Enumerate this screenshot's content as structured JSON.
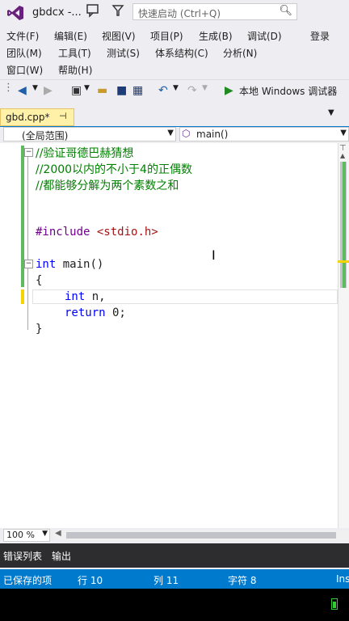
{
  "window": {
    "title": "gbdcx -..."
  },
  "quick_launch": {
    "placeholder": "快速启动 (Ctrl+Q)"
  },
  "menu": {
    "row1": [
      "文件(F)",
      "编辑(E)",
      "视图(V)",
      "项目(P)",
      "生成(B)",
      "调试(D)"
    ],
    "login": "登录",
    "row2": [
      "团队(M)",
      "工具(T)",
      "测试(S)",
      "体系结构(C)",
      "分析(N)"
    ],
    "row3": [
      "窗口(W)",
      "帮助(H)"
    ]
  },
  "toolbar": {
    "run_label": "本地 Windows 调试器"
  },
  "tab": {
    "label": "gbd.cpp*",
    "pin": "⊣"
  },
  "navbar": {
    "scope": "(全局范围)",
    "function": "main()"
  },
  "code": {
    "line1": "//验证哥德巴赫猜想",
    "line2": "//2000以内的不小于4的正偶数",
    "line3": "//都能够分解为两个素数之和",
    "line4_directive": "#include",
    "line4_header": "<stdio.h>",
    "line5_type": "int",
    "line5_rest": " main()",
    "line6": "{",
    "line7_type": "int",
    "line7_rest": " n,",
    "line8_kw": "return",
    "line8_rest": " 0;",
    "line9": "}"
  },
  "zoom": {
    "value": "100 %"
  },
  "output_tabs": [
    "错误列表",
    "输出"
  ],
  "status": {
    "saved": "已保存的项",
    "row": "行 10",
    "col": "列 11",
    "char": "字符 8",
    "mode": "Ins"
  },
  "colors": {
    "accent": "#007acc",
    "comment": "#008000",
    "keyword": "#0000ff",
    "preprocessor": "#6f008a",
    "string": "#a31515"
  }
}
